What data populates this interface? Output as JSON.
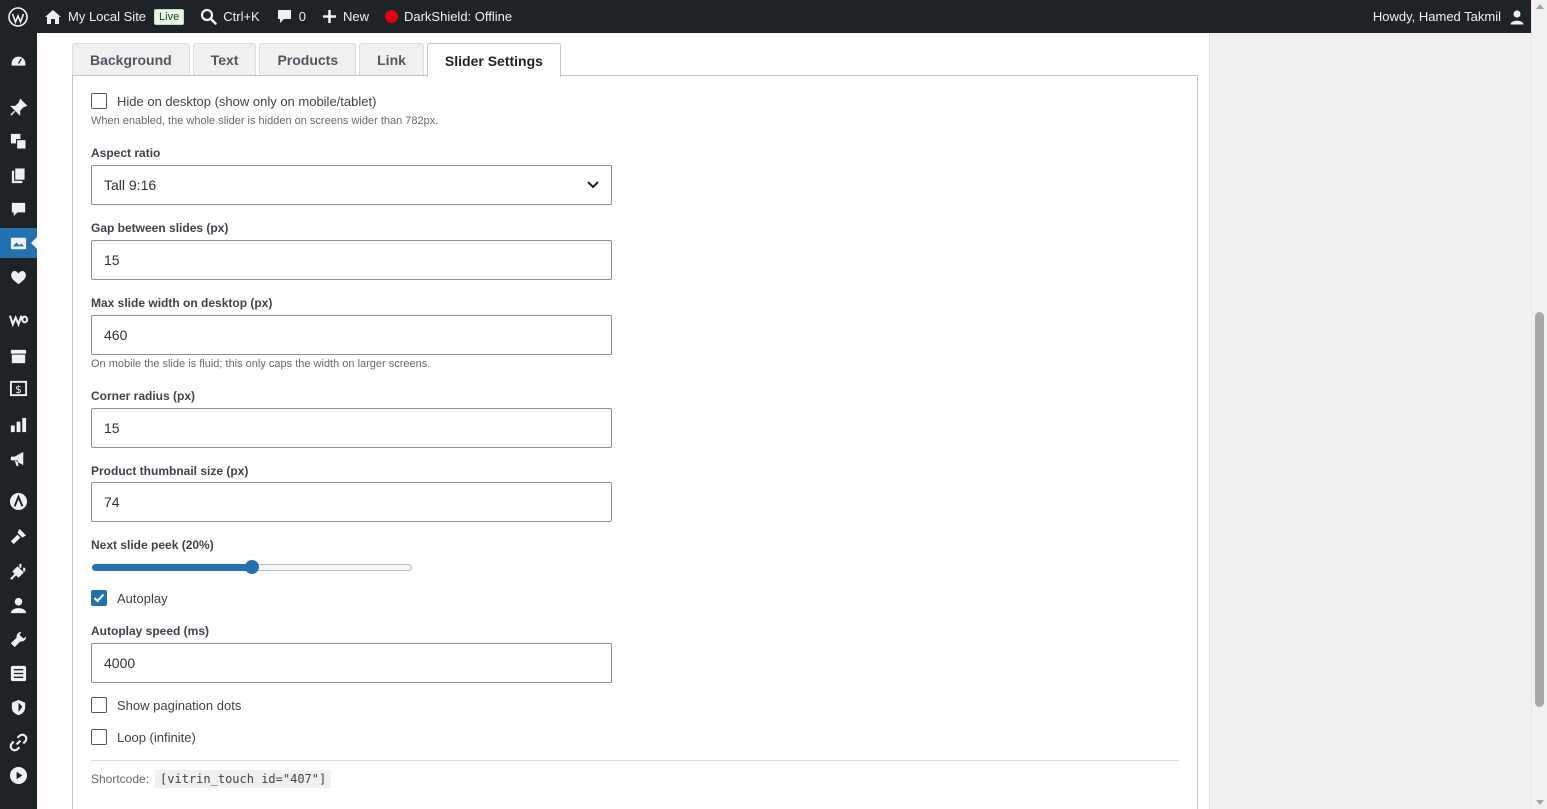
{
  "adminbar": {
    "site_name": "My Local Site",
    "live_badge": "Live",
    "search_shortcut": "Ctrl+K",
    "comments_count": "0",
    "new_label": "New",
    "darkshield_status": "DarkShield: Offline",
    "howdy": "Howdy, Hamed Takmil"
  },
  "tabs": [
    {
      "label": "Background"
    },
    {
      "label": "Text"
    },
    {
      "label": "Products"
    },
    {
      "label": "Link"
    },
    {
      "label": "Slider Settings"
    }
  ],
  "settings": {
    "hide_desktop": {
      "label": "Hide on desktop (show only on mobile/tablet)",
      "checked": false,
      "hint": "When enabled, the whole slider is hidden on screens wider than 782px."
    },
    "aspect_ratio": {
      "label": "Aspect ratio",
      "value": "Tall 9:16"
    },
    "gap": {
      "label": "Gap between slides (px)",
      "value": "15"
    },
    "max_width": {
      "label": "Max slide width on desktop (px)",
      "value": "460",
      "hint": "On mobile the slide is fluid; this only caps the width on larger screens."
    },
    "corner_radius": {
      "label": "Corner radius (px)",
      "value": "15"
    },
    "thumb_size": {
      "label": "Product thumbnail size (px)",
      "value": "74"
    },
    "peek": {
      "label": "Next slide peek (20%)",
      "value_percent": 20,
      "slider_fraction": 0.5
    },
    "autoplay": {
      "label": "Autoplay",
      "checked": true
    },
    "autoplay_speed": {
      "label": "Autoplay speed (ms)",
      "value": "4000"
    },
    "pagination_dots": {
      "label": "Show pagination dots",
      "checked": false
    },
    "loop": {
      "label": "Loop (infinite)",
      "checked": false
    }
  },
  "shortcode": {
    "label": "Shortcode:",
    "code": "[vitrin_touch id=\"407\"]"
  },
  "colors": {
    "accent": "#2271b1",
    "adminbar": "#1d2327",
    "status_offline": "#e3000f"
  },
  "icons": {
    "sidebar": [
      "dashboard-icon",
      "pin-icon",
      "media-icon",
      "pages-icon",
      "comments-icon",
      "slider-icon",
      "heart-icon",
      "woo-icon",
      "archive-icon",
      "dollar-icon",
      "chart-icon",
      "megaphone-icon",
      "astra-icon",
      "brush-icon",
      "plugin-icon",
      "users-icon",
      "wrench-icon",
      "settings-icon",
      "shield-icon",
      "link-icon",
      "play-icon"
    ]
  }
}
